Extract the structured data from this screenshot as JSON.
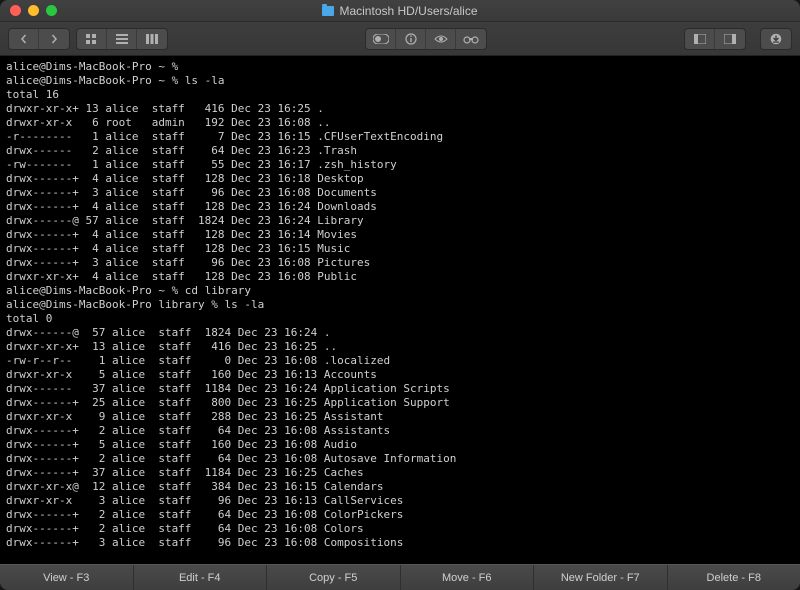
{
  "window": {
    "title": "Macintosh HD/Users/alice"
  },
  "bottom": {
    "view": "View - F3",
    "edit": "Edit - F4",
    "copy": "Copy - F5",
    "move": "Move - F6",
    "newfolder": "New Folder - F7",
    "delete": "Delete - F8"
  },
  "terminal": {
    "lines": [
      "alice@Dims-MacBook-Pro ~ %",
      "alice@Dims-MacBook-Pro ~ % ls -la",
      "total 16",
      "drwxr-xr-x+ 13 alice  staff   416 Dec 23 16:25 .",
      "drwxr-xr-x   6 root   admin   192 Dec 23 16:08 ..",
      "-r--------   1 alice  staff     7 Dec 23 16:15 .CFUserTextEncoding",
      "drwx------   2 alice  staff    64 Dec 23 16:23 .Trash",
      "-rw-------   1 alice  staff    55 Dec 23 16:17 .zsh_history",
      "drwx------+  4 alice  staff   128 Dec 23 16:18 Desktop",
      "drwx------+  3 alice  staff    96 Dec 23 16:08 Documents",
      "drwx------+  4 alice  staff   128 Dec 23 16:24 Downloads",
      "drwx------@ 57 alice  staff  1824 Dec 23 16:24 Library",
      "drwx------+  4 alice  staff   128 Dec 23 16:14 Movies",
      "drwx------+  4 alice  staff   128 Dec 23 16:15 Music",
      "drwx------+  3 alice  staff    96 Dec 23 16:08 Pictures",
      "drwxr-xr-x+  4 alice  staff   128 Dec 23 16:08 Public",
      "alice@Dims-MacBook-Pro ~ % cd library",
      "alice@Dims-MacBook-Pro library % ls -la",
      "total 0",
      "drwx------@  57 alice  staff  1824 Dec 23 16:24 .",
      "drwxr-xr-x+  13 alice  staff   416 Dec 23 16:25 ..",
      "-rw-r--r--    1 alice  staff     0 Dec 23 16:08 .localized",
      "drwxr-xr-x    5 alice  staff   160 Dec 23 16:13 Accounts",
      "drwx------   37 alice  staff  1184 Dec 23 16:24 Application Scripts",
      "drwx------+  25 alice  staff   800 Dec 23 16:25 Application Support",
      "drwxr-xr-x    9 alice  staff   288 Dec 23 16:25 Assistant",
      "drwx------+   2 alice  staff    64 Dec 23 16:08 Assistants",
      "drwx------+   5 alice  staff   160 Dec 23 16:08 Audio",
      "drwx------+   2 alice  staff    64 Dec 23 16:08 Autosave Information",
      "drwx------+  37 alice  staff  1184 Dec 23 16:25 Caches",
      "drwxr-xr-x@  12 alice  staff   384 Dec 23 16:15 Calendars",
      "drwxr-xr-x    3 alice  staff    96 Dec 23 16:13 CallServices",
      "drwx------+   2 alice  staff    64 Dec 23 16:08 ColorPickers",
      "drwx------+   2 alice  staff    64 Dec 23 16:08 Colors",
      "drwx------+   3 alice  staff    96 Dec 23 16:08 Compositions"
    ]
  }
}
